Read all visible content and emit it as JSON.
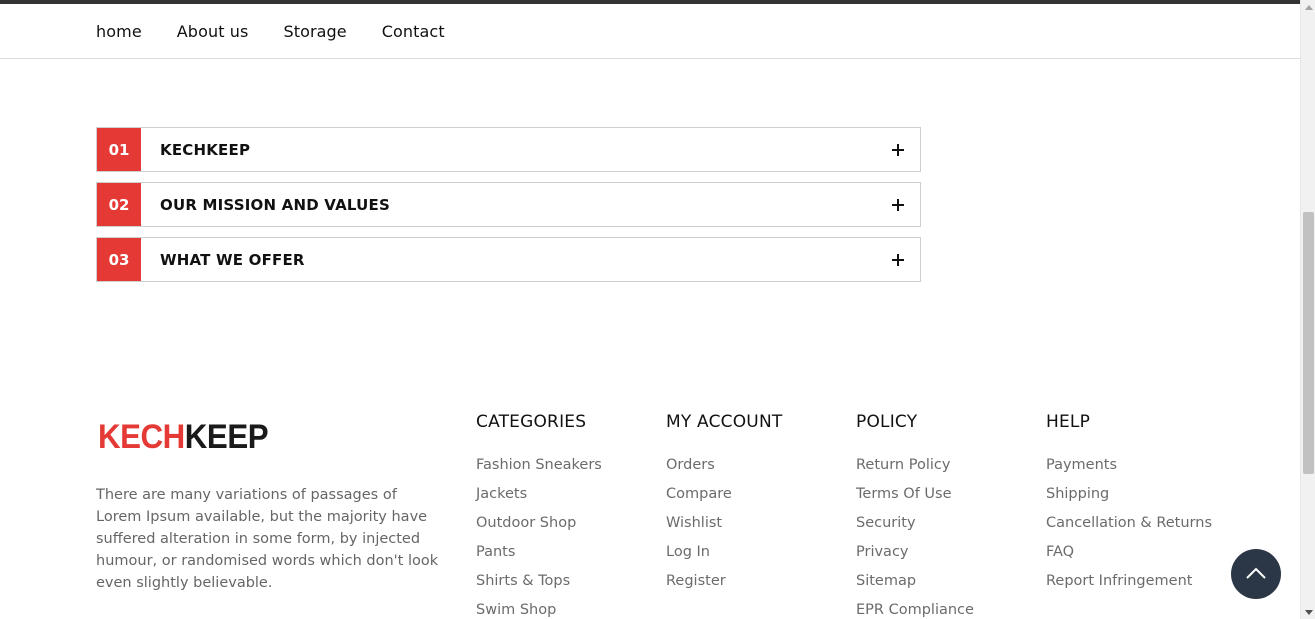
{
  "nav": {
    "items": [
      "home",
      "About us",
      "Storage",
      "Contact"
    ]
  },
  "accordion": {
    "items": [
      {
        "num": "01",
        "title": "KECHKEEP"
      },
      {
        "num": "02",
        "title": "OUR MISSION AND VALUES"
      },
      {
        "num": "03",
        "title": "WHAT WE OFFER"
      }
    ],
    "expand_icon": "plus-icon"
  },
  "footer": {
    "logo": {
      "part1": "KECH",
      "part2": "KEEP"
    },
    "about": "There are many variations of passages of Lorem Ipsum available, but the majority have suffered alteration in some form, by injected humour, or randomised words which don't look even slightly believable.",
    "columns": [
      {
        "title": "CATEGORIES",
        "links": [
          "Fashion Sneakers",
          "Jackets",
          "Outdoor Shop",
          "Pants",
          "Shirts & Tops",
          "Swim Shop"
        ]
      },
      {
        "title": "MY ACCOUNT",
        "links": [
          "Orders",
          "Compare",
          "Wishlist",
          "Log In",
          "Register"
        ]
      },
      {
        "title": "POLICY",
        "links": [
          "Return Policy",
          "Terms Of Use",
          "Security",
          "Privacy",
          "Sitemap",
          "EPR Compliance"
        ]
      },
      {
        "title": "HELP",
        "links": [
          "Payments",
          "Shipping",
          "Cancellation & Returns",
          "FAQ",
          "Report Infringement"
        ]
      }
    ]
  },
  "back_to_top": {
    "icon": "chevron-up-icon"
  },
  "colors": {
    "accent": "#e53935",
    "dark_button": "#2b3646",
    "text_muted": "#6b6b6b"
  }
}
